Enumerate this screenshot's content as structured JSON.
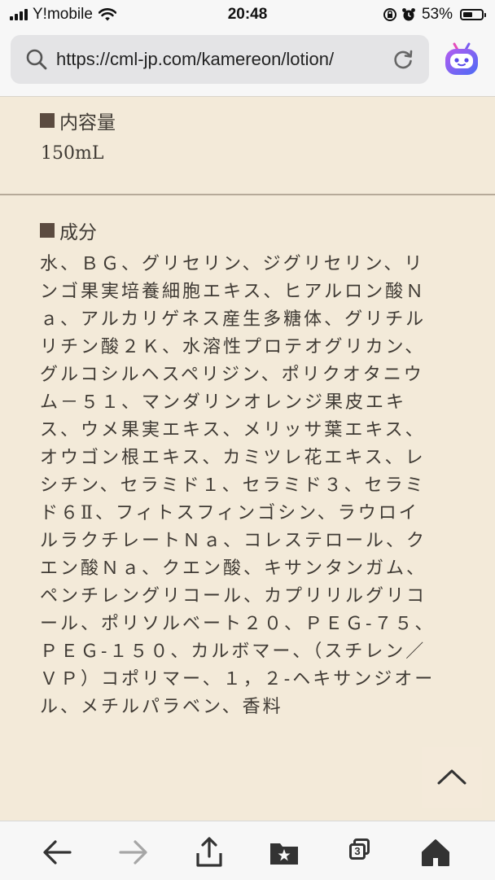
{
  "status_bar": {
    "carrier": "Y!mobile",
    "time": "20:48",
    "battery_percent": "53%",
    "battery_level": 0.53
  },
  "browser": {
    "url": "https://cml-jp.com/kamereon/lotion/"
  },
  "content": {
    "volume": {
      "heading": "内容量",
      "value": "150mL"
    },
    "ingredients": {
      "heading": "成分",
      "lines": [
        "水、ＢＧ、グリセリン、ジグリセリン、リ",
        "ンゴ果実培養細胞エキス、ヒアルロン酸Ｎ",
        "ａ、アルカリゲネス産生多糖体、グリチル",
        "リチン酸２Ｋ、水溶性プロテオグリカン、",
        "グルコシルヘスペリジン、ポリクオタニウ",
        "ム－５１、マンダリンオレンジ果皮エキ",
        "ス、ウメ果実エキス、メリッサ葉エキス、",
        "オウゴン根エキス、カミツレ花エキス、レ",
        "シチン、セラミド１、セラミド３、セラミ",
        "ド６Ⅱ、フィトスフィンゴシン、ラウロイ",
        "ルラクチレートＮａ、コレステロール、ク",
        "エン酸Ｎａ、クエン酸、キサンタンガム、",
        "ペンチレングリコール、カプリリルグリコ",
        "ール、ポリソルベート２０、ＰＥＧ-７５、",
        "ＰＥＧ-１５０、カルボマー、（スチレン／",
        "ＶＰ）コポリマー、１，２-ヘキサンジオー",
        "ル、メチルパラベン、香料"
      ]
    }
  },
  "toolbar": {
    "tab_count": "3"
  },
  "colors": {
    "page_background": "#f3ead9",
    "text": "#3f3a34",
    "heading_square": "#5b4b40",
    "divider": "#b6aa99"
  }
}
